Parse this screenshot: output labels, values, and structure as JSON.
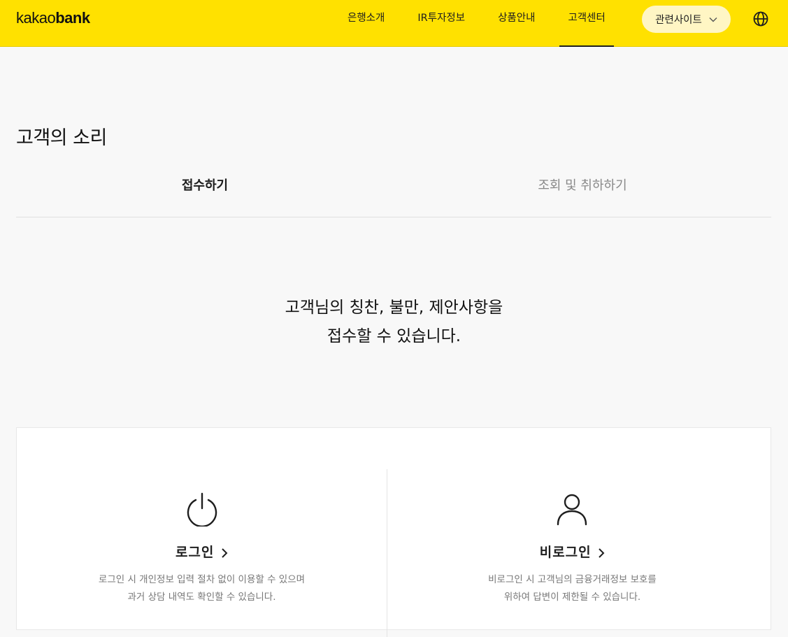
{
  "header": {
    "logo_light": "kakao",
    "logo_bold": "bank",
    "nav": [
      {
        "label": "은행소개"
      },
      {
        "label": "IR투자정보"
      },
      {
        "label": "상품안내"
      },
      {
        "label": "고객센터",
        "active": true
      }
    ],
    "related_sites_label": "관련사이트",
    "language_icon": "globe-icon",
    "colors": {
      "background": "#ffe100",
      "related_button": "#fff6c4"
    }
  },
  "page": {
    "title": "고객의 소리",
    "tabs": [
      {
        "label": "접수하기",
        "active": true
      },
      {
        "label": "조회 및 취하하기",
        "active": false
      }
    ],
    "intro_line1": "고객님의 칭찬, 불만, 제안사항을",
    "intro_line2": "접수할 수 있습니다."
  },
  "options": {
    "login": {
      "icon": "power-icon",
      "title": "로그인",
      "desc_line1": "로그인 시 개인정보 입력 절차 없이 이용할 수 있으며",
      "desc_line2": "과거 상담 내역도 확인할 수 있습니다."
    },
    "guest": {
      "icon": "person-icon",
      "title": "비로그인",
      "desc_line1": "비로그인 시 고객님의 금융거래정보 보호를",
      "desc_line2": "위하여 답변이 제한될 수 있습니다."
    }
  }
}
